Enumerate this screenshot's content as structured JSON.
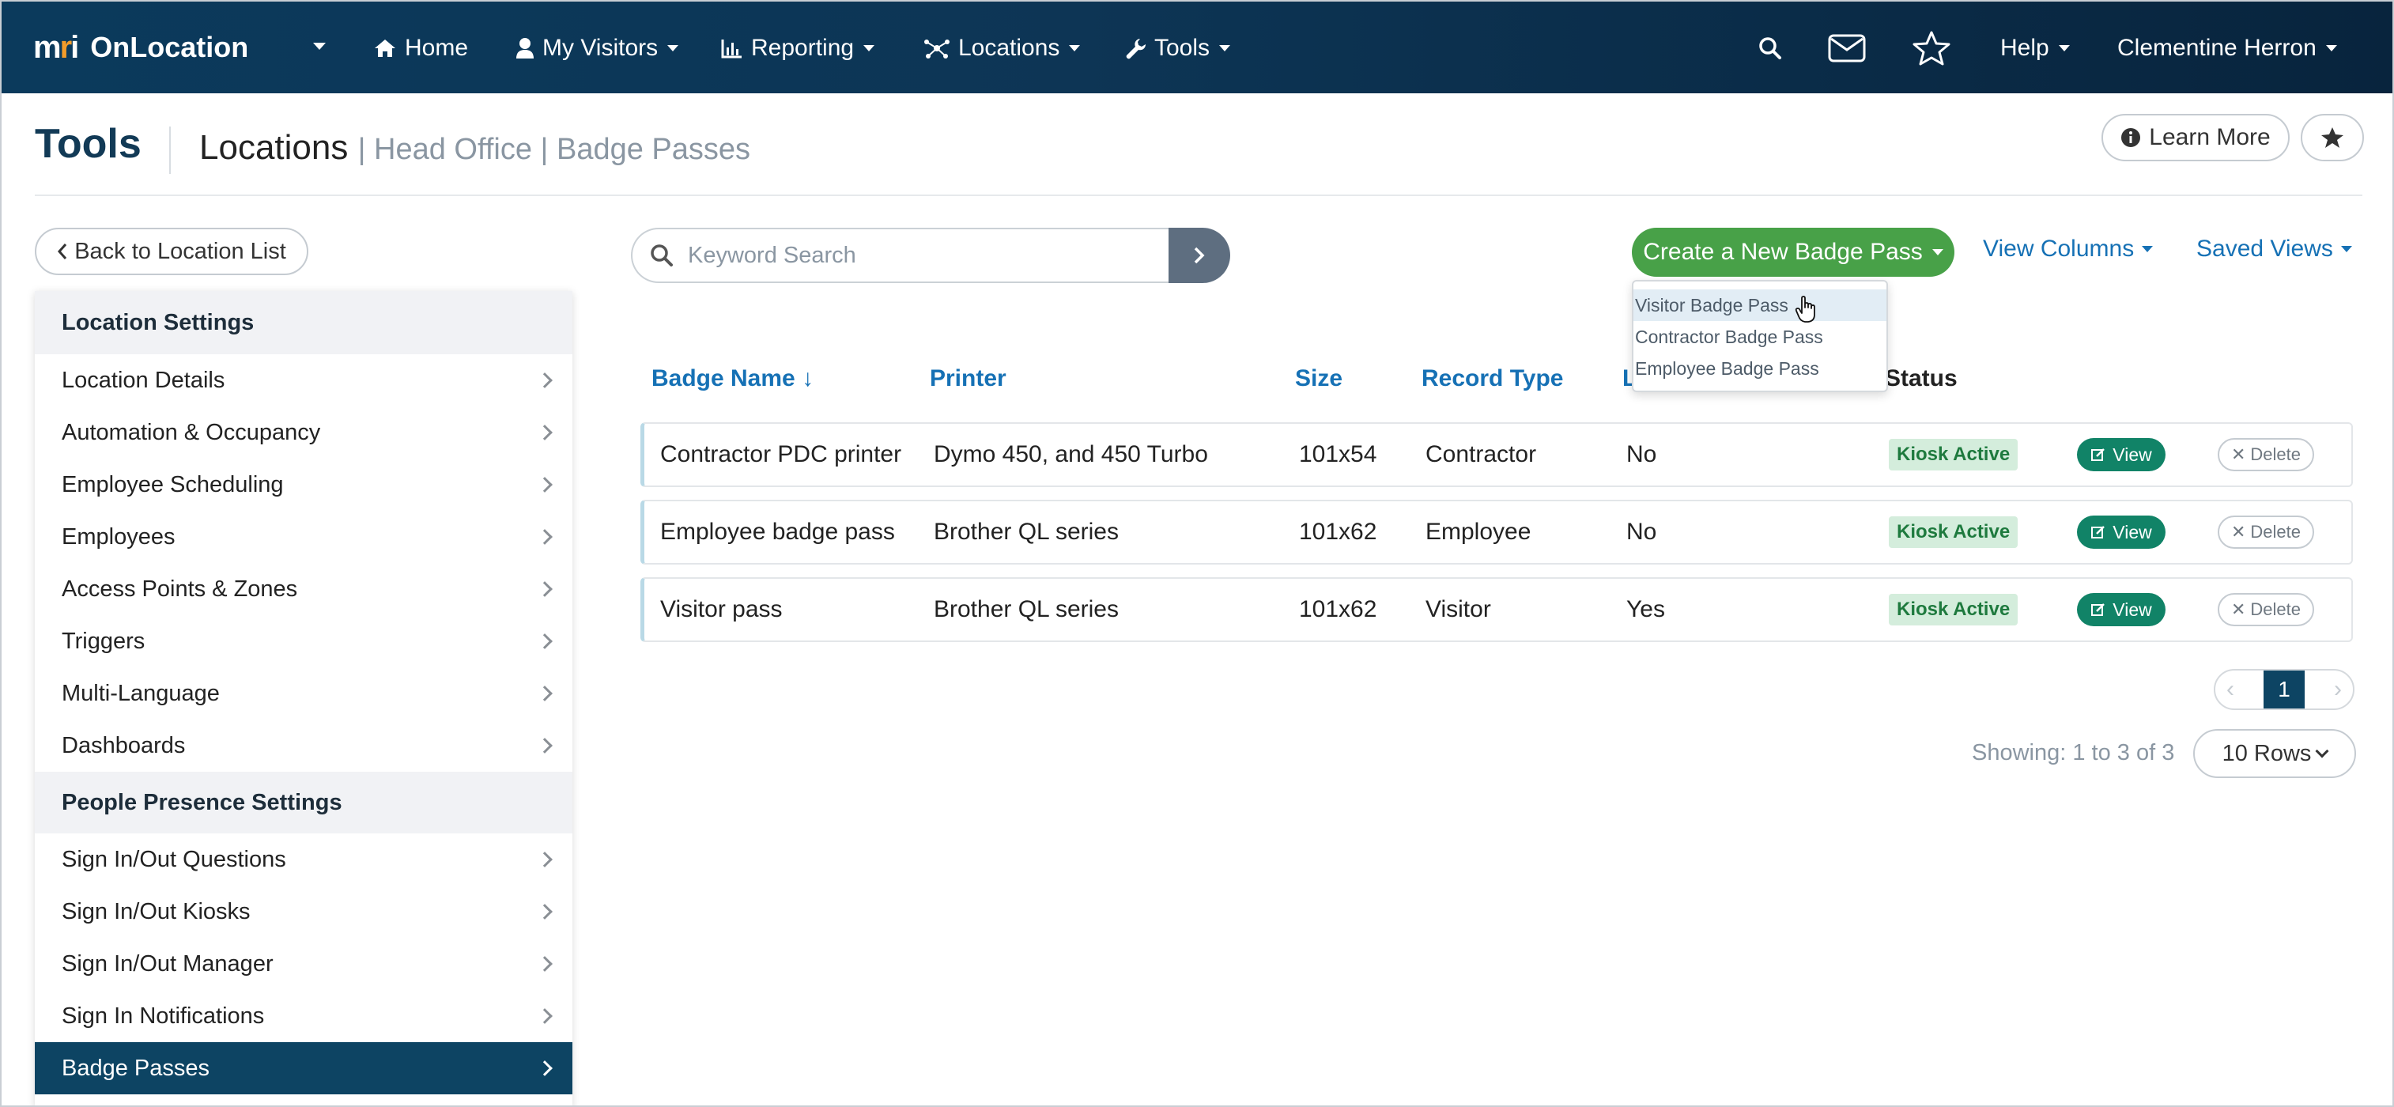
{
  "app": {
    "logo_text": "mri",
    "name": "OnLocation"
  },
  "nav": {
    "home": "Home",
    "my_visitors": "My Visitors",
    "reporting": "Reporting",
    "locations": "Locations",
    "tools": "Tools",
    "help": "Help",
    "user": "Clementine Herron"
  },
  "header": {
    "title": "Tools",
    "breadcrumb_main": "Locations",
    "breadcrumb_rest": "| Head Office | Badge Passes",
    "learn_more": "Learn More"
  },
  "sidebar": {
    "back_label": "Back to Location List",
    "section1": "Location Settings",
    "items1": [
      "Location Details",
      "Automation & Occupancy",
      "Employee Scheduling",
      "Employees",
      "Access Points & Zones",
      "Triggers",
      "Multi-Language",
      "Dashboards"
    ],
    "section2": "People Presence Settings",
    "items2": [
      "Sign In/Out Questions",
      "Sign In/Out Kiosks",
      "Sign In/Out Manager",
      "Sign In Notifications",
      "Badge Passes"
    ],
    "active_item": "Badge Passes"
  },
  "search": {
    "placeholder": "Keyword Search"
  },
  "toolbar": {
    "create_label": "Create a New Badge Pass",
    "view_columns": "View Columns",
    "saved_views": "Saved Views"
  },
  "dropdown": {
    "items": [
      "Visitor Badge Pass",
      "Contractor Badge Pass",
      "Employee Badge Pass"
    ],
    "hovered": "Visitor Badge Pass"
  },
  "table": {
    "headers": {
      "badge_name": "Badge Name",
      "sort_indicator": "↓",
      "printer": "Printer",
      "size": "Size",
      "record_type": "Record Type",
      "col5_partial": "L",
      "status": "Status"
    },
    "rows": [
      {
        "badge_name": "Contractor PDC printer",
        "printer": "Dymo 450, and 450 Turbo",
        "size": "101x54",
        "record_type": "Contractor",
        "col5": "No",
        "status": "Kiosk Active"
      },
      {
        "badge_name": "Employee badge pass",
        "printer": "Brother QL series",
        "size": "101x62",
        "record_type": "Employee",
        "col5": "No",
        "status": "Kiosk Active"
      },
      {
        "badge_name": "Visitor pass",
        "printer": "Brother QL series",
        "size": "101x62",
        "record_type": "Visitor",
        "col5": "Yes",
        "status": "Kiosk Active"
      }
    ],
    "view_label": "View",
    "delete_label": "Delete"
  },
  "pagination": {
    "current_page": "1",
    "showing": "Showing: 1 to 3 of 3",
    "rows_per_page": "10 Rows"
  },
  "colors": {
    "navbar": "#0b3a5c",
    "accent_blue": "#1671b5",
    "create_green": "#48a148",
    "view_teal": "#118367",
    "active_sidebar": "#0d4463"
  }
}
